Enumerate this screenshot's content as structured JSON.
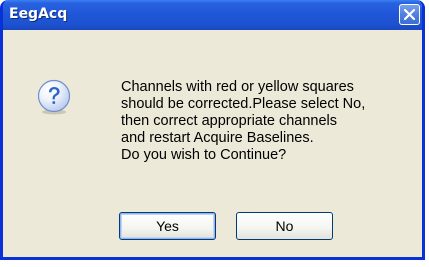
{
  "window": {
    "title": "EegAcq"
  },
  "dialog": {
    "icon": "question-icon",
    "message_lines": [
      "Channels with red or yellow squares",
      "should be corrected.Please select No,",
      "then correct appropriate channels",
      "and restart Acquire Baselines.",
      "Do you wish to Continue?"
    ],
    "buttons": {
      "yes_label": "Yes",
      "no_label": "No"
    }
  },
  "colors": {
    "titlebar": "#1f57d9",
    "window_border": "#0831d9",
    "dialog_background": "#ece9d8",
    "icon_fill": "#2f64c8"
  }
}
